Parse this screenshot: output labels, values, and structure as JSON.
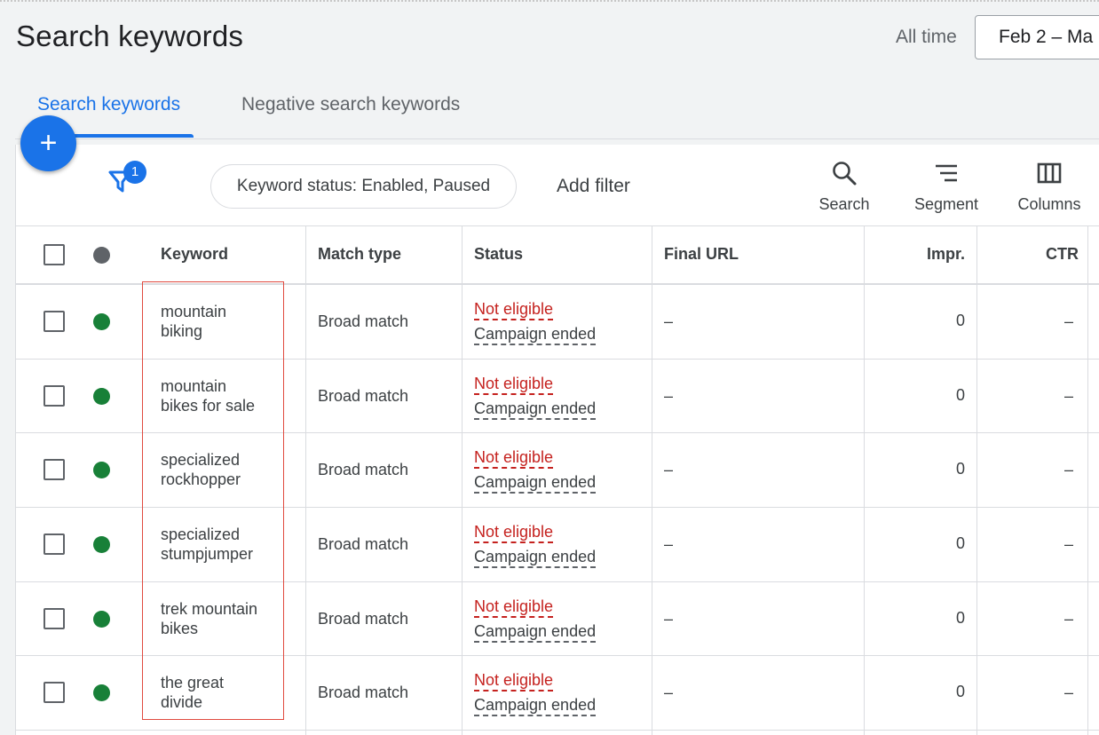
{
  "header": {
    "title": "Search keywords",
    "date_range_label": "All time",
    "date_range_value": "Feb 2 – Ma"
  },
  "tabs": [
    {
      "label": "Search keywords",
      "active": true
    },
    {
      "label": "Negative search keywords",
      "active": false
    }
  ],
  "toolbar": {
    "fab_label": "+",
    "filter_count": "1",
    "filter_chip": "Keyword status: Enabled, Paused",
    "add_filter": "Add filter",
    "search_label": "Search",
    "segment_label": "Segment",
    "columns_label": "Columns"
  },
  "table": {
    "headers": {
      "keyword": "Keyword",
      "match_type": "Match type",
      "status": "Status",
      "final_url": "Final URL",
      "impr": "Impr.",
      "ctr": "CTR"
    },
    "header_dot_color": "#5f6368",
    "enabled_dot_color": "#188038",
    "rows": [
      {
        "keyword_line1": "mountain",
        "keyword_line2": "biking",
        "match_type": "Broad match",
        "status": "Not eligible",
        "status_reason": "Campaign ended",
        "final_url": "–",
        "impr": "0",
        "ctr": "–"
      },
      {
        "keyword_line1": "mountain",
        "keyword_line2": "bikes for sale",
        "match_type": "Broad match",
        "status": "Not eligible",
        "status_reason": "Campaign ended",
        "final_url": "–",
        "impr": "0",
        "ctr": "–"
      },
      {
        "keyword_line1": "specialized",
        "keyword_line2": "rockhopper",
        "match_type": "Broad match",
        "status": "Not eligible",
        "status_reason": "Campaign ended",
        "final_url": "–",
        "impr": "0",
        "ctr": "–"
      },
      {
        "keyword_line1": "specialized",
        "keyword_line2": "stumpjumper",
        "match_type": "Broad match",
        "status": "Not eligible",
        "status_reason": "Campaign ended",
        "final_url": "–",
        "impr": "0",
        "ctr": "–"
      },
      {
        "keyword_line1": "trek mountain",
        "keyword_line2": "bikes",
        "match_type": "Broad match",
        "status": "Not eligible",
        "status_reason": "Campaign ended",
        "final_url": "–",
        "impr": "0",
        "ctr": "–"
      },
      {
        "keyword_line1": "the great",
        "keyword_line2": "divide",
        "match_type": "Broad match",
        "status": "Not eligible",
        "status_reason": "Campaign ended",
        "final_url": "–",
        "impr": "0",
        "ctr": "–"
      }
    ]
  },
  "colors": {
    "accent": "#1a73e8",
    "status_error": "#c5221f",
    "highlight": "#e04a3f"
  }
}
